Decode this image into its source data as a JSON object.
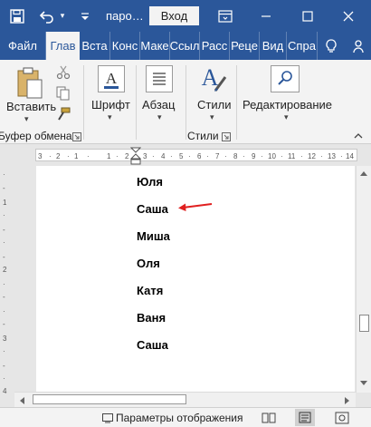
{
  "titlebar": {
    "title": "паро…",
    "signin_label": "Вход",
    "bg_color": "#2b579a"
  },
  "tabs": [
    {
      "label": "Файл"
    },
    {
      "label": "Глав",
      "active": true
    },
    {
      "label": "Вста"
    },
    {
      "label": "Конс"
    },
    {
      "label": "Маке"
    },
    {
      "label": "Ссыл"
    },
    {
      "label": "Расс"
    },
    {
      "label": "Реце"
    },
    {
      "label": "Вид"
    },
    {
      "label": "Спра"
    }
  ],
  "ribbon": {
    "paste_label": "Вставить",
    "clipboard_group": "Буфер обмена",
    "font_label": "Шрифт",
    "paragraph_label": "Абзац",
    "styles_label": "Стили",
    "styles_group": "Стили",
    "editing_label": "Редактирование"
  },
  "document": {
    "names": [
      "Юля",
      "Саша",
      "Миша",
      "Оля",
      "Катя",
      "Ваня",
      "Саша"
    ],
    "arrow_color": "#e02020"
  },
  "statusbar": {
    "display_settings": "Параметры отображения"
  }
}
